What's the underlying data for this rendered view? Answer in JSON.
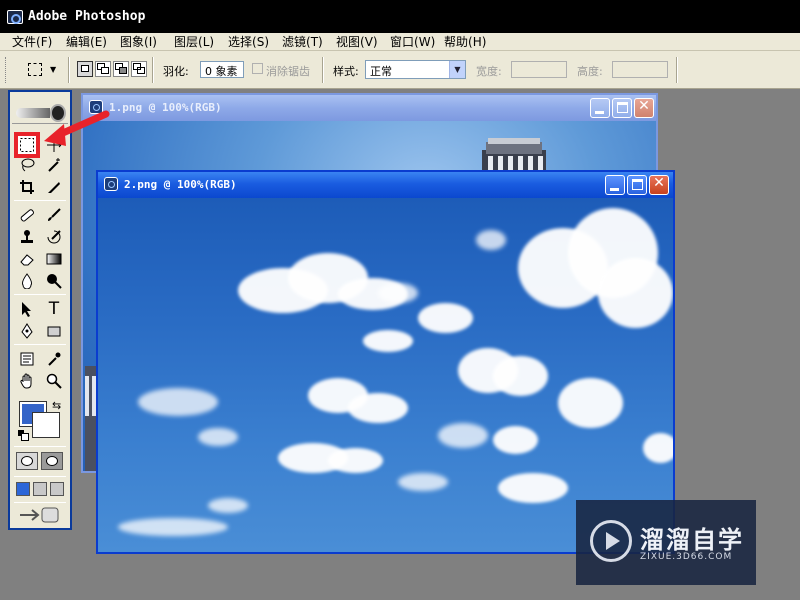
{
  "app": {
    "title": "Adobe Photoshop"
  },
  "menu": [
    {
      "label": "文件",
      "key": "F"
    },
    {
      "label": "编辑",
      "key": "E"
    },
    {
      "label": "图象",
      "key": "I"
    },
    {
      "label": "图层",
      "key": "L"
    },
    {
      "label": "选择",
      "key": "S"
    },
    {
      "label": "滤镜",
      "key": "T"
    },
    {
      "label": "视图",
      "key": "V"
    },
    {
      "label": "窗口",
      "key": "W"
    },
    {
      "label": "帮助",
      "key": "H"
    }
  ],
  "options": {
    "feather_label": "羽化:",
    "feather_value": "0 象素",
    "antialias_label": "消除锯齿",
    "style_label": "样式:",
    "style_value": "正常",
    "width_label": "宽度:",
    "height_label": "高度:"
  },
  "toolbox": {
    "foreground_color": "#3464c8",
    "background_color": "#ffffff",
    "type_tool_glyph": "T"
  },
  "documents": [
    {
      "name": "1.png @ 100%(RGB)",
      "active": false
    },
    {
      "name": "2.png @ 100%(RGB)",
      "active": true
    }
  ],
  "window_controls": {
    "close_glyph": "✕"
  },
  "watermark": {
    "name": "溜溜自学",
    "url": "ZIXUE.3D66.COM"
  }
}
